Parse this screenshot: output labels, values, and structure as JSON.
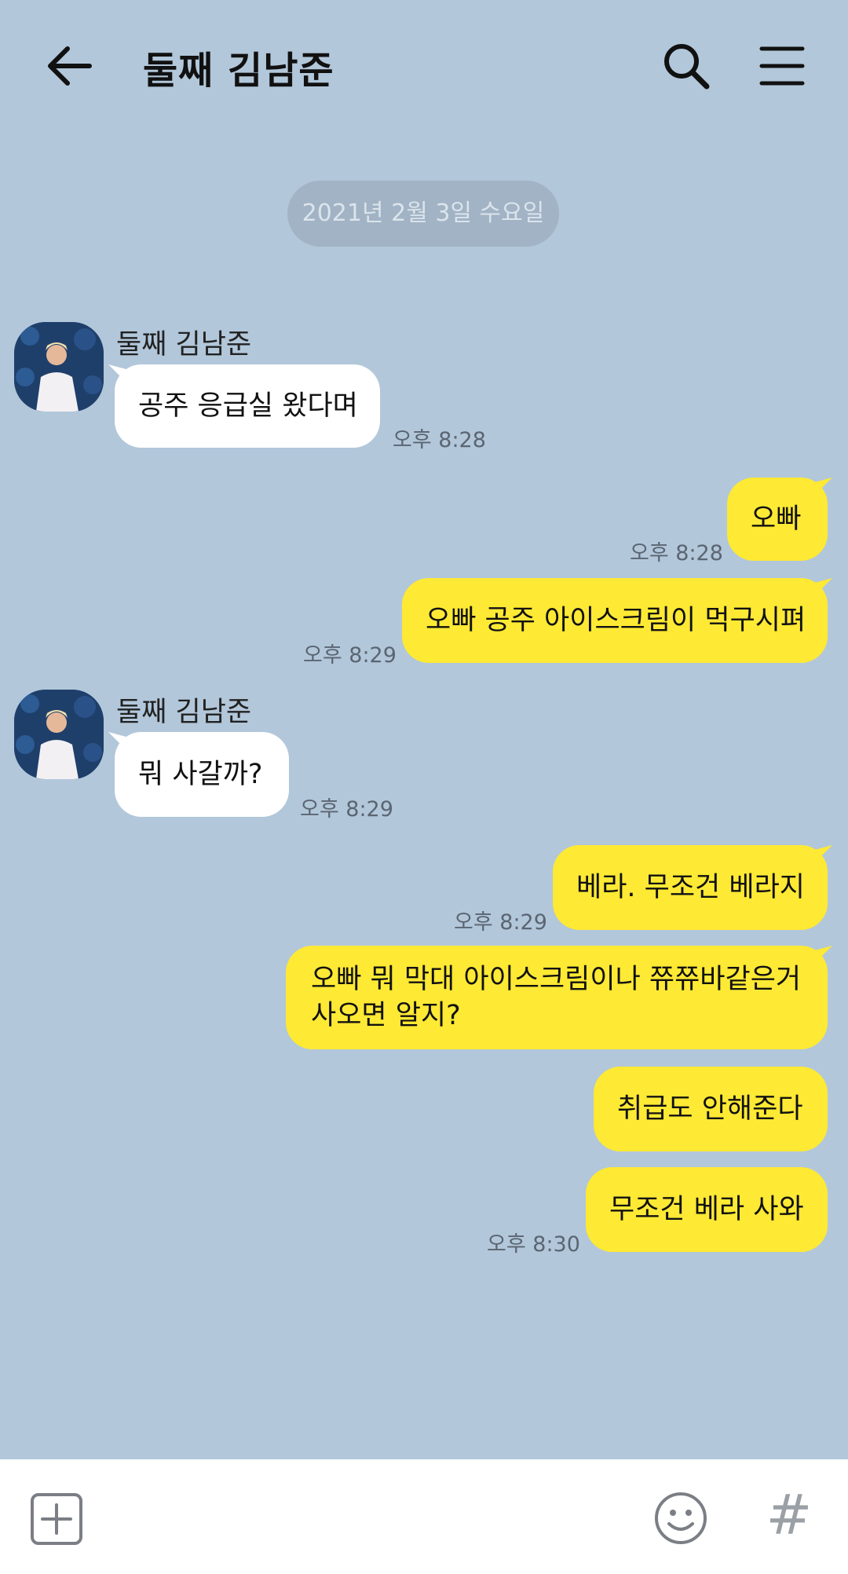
{
  "header": {
    "title": "둘째 김남준",
    "back_icon": "arrow-left-icon",
    "search_icon": "search-icon",
    "menu_icon": "hamburger-menu-icon"
  },
  "date_divider": "2021년 2월 3일 수요일",
  "contact_name": "둘째 김남준",
  "messages": [
    {
      "side": "received",
      "sender": "둘째 김남준",
      "text": "공주 응급실 왔다며",
      "time": "오후 8:28"
    },
    {
      "side": "sent",
      "text": "오빠",
      "time": "오후 8:28"
    },
    {
      "side": "sent",
      "text": "오빠 공주 아이스크림이 먹구시펴",
      "time": "오후 8:29"
    },
    {
      "side": "received",
      "sender": "둘째 김남준",
      "text": "뭐 사갈까?",
      "time": "오후 8:29"
    },
    {
      "side": "sent",
      "text": "베라. 무조건 베라지",
      "time": "오후 8:29"
    },
    {
      "side": "sent",
      "text": "오빠 뭐 막대 아이스크림이나 쮸쮸바같은거 사오면 알지?",
      "time": ""
    },
    {
      "side": "sent",
      "text": "취급도 안해준다",
      "time": ""
    },
    {
      "side": "sent",
      "text": "무조건 베라 사와",
      "time": "오후 8:30"
    }
  ],
  "bottom_bar": {
    "add_icon": "plus-square-icon",
    "emoji_icon": "smiley-icon",
    "hash_label": "#"
  },
  "colors": {
    "background": "#b2c7da",
    "sent_bubble": "#fee934",
    "received_bubble": "#ffffff"
  }
}
